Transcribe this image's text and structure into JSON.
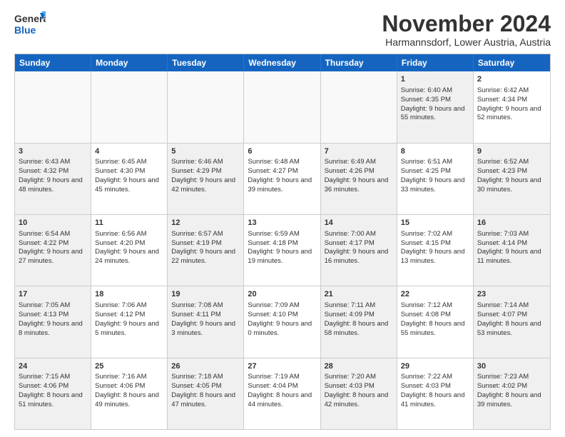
{
  "logo": {
    "line1": "General",
    "line2": "Blue"
  },
  "title": "November 2024",
  "subtitle": "Harmannsdorf, Lower Austria, Austria",
  "header_days": [
    "Sunday",
    "Monday",
    "Tuesday",
    "Wednesday",
    "Thursday",
    "Friday",
    "Saturday"
  ],
  "weeks": [
    [
      {
        "day": "",
        "info": "",
        "empty": true
      },
      {
        "day": "",
        "info": "",
        "empty": true
      },
      {
        "day": "",
        "info": "",
        "empty": true
      },
      {
        "day": "",
        "info": "",
        "empty": true
      },
      {
        "day": "",
        "info": "",
        "empty": true
      },
      {
        "day": "1",
        "info": "Sunrise: 6:40 AM\nSunset: 4:35 PM\nDaylight: 9 hours and 55 minutes.",
        "empty": false,
        "shaded": true
      },
      {
        "day": "2",
        "info": "Sunrise: 6:42 AM\nSunset: 4:34 PM\nDaylight: 9 hours and 52 minutes.",
        "empty": false,
        "shaded": false
      }
    ],
    [
      {
        "day": "3",
        "info": "Sunrise: 6:43 AM\nSunset: 4:32 PM\nDaylight: 9 hours and 48 minutes.",
        "empty": false,
        "shaded": true
      },
      {
        "day": "4",
        "info": "Sunrise: 6:45 AM\nSunset: 4:30 PM\nDaylight: 9 hours and 45 minutes.",
        "empty": false,
        "shaded": false
      },
      {
        "day": "5",
        "info": "Sunrise: 6:46 AM\nSunset: 4:29 PM\nDaylight: 9 hours and 42 minutes.",
        "empty": false,
        "shaded": true
      },
      {
        "day": "6",
        "info": "Sunrise: 6:48 AM\nSunset: 4:27 PM\nDaylight: 9 hours and 39 minutes.",
        "empty": false,
        "shaded": false
      },
      {
        "day": "7",
        "info": "Sunrise: 6:49 AM\nSunset: 4:26 PM\nDaylight: 9 hours and 36 minutes.",
        "empty": false,
        "shaded": true
      },
      {
        "day": "8",
        "info": "Sunrise: 6:51 AM\nSunset: 4:25 PM\nDaylight: 9 hours and 33 minutes.",
        "empty": false,
        "shaded": false
      },
      {
        "day": "9",
        "info": "Sunrise: 6:52 AM\nSunset: 4:23 PM\nDaylight: 9 hours and 30 minutes.",
        "empty": false,
        "shaded": true
      }
    ],
    [
      {
        "day": "10",
        "info": "Sunrise: 6:54 AM\nSunset: 4:22 PM\nDaylight: 9 hours and 27 minutes.",
        "empty": false,
        "shaded": true
      },
      {
        "day": "11",
        "info": "Sunrise: 6:56 AM\nSunset: 4:20 PM\nDaylight: 9 hours and 24 minutes.",
        "empty": false,
        "shaded": false
      },
      {
        "day": "12",
        "info": "Sunrise: 6:57 AM\nSunset: 4:19 PM\nDaylight: 9 hours and 22 minutes.",
        "empty": false,
        "shaded": true
      },
      {
        "day": "13",
        "info": "Sunrise: 6:59 AM\nSunset: 4:18 PM\nDaylight: 9 hours and 19 minutes.",
        "empty": false,
        "shaded": false
      },
      {
        "day": "14",
        "info": "Sunrise: 7:00 AM\nSunset: 4:17 PM\nDaylight: 9 hours and 16 minutes.",
        "empty": false,
        "shaded": true
      },
      {
        "day": "15",
        "info": "Sunrise: 7:02 AM\nSunset: 4:15 PM\nDaylight: 9 hours and 13 minutes.",
        "empty": false,
        "shaded": false
      },
      {
        "day": "16",
        "info": "Sunrise: 7:03 AM\nSunset: 4:14 PM\nDaylight: 9 hours and 11 minutes.",
        "empty": false,
        "shaded": true
      }
    ],
    [
      {
        "day": "17",
        "info": "Sunrise: 7:05 AM\nSunset: 4:13 PM\nDaylight: 9 hours and 8 minutes.",
        "empty": false,
        "shaded": true
      },
      {
        "day": "18",
        "info": "Sunrise: 7:06 AM\nSunset: 4:12 PM\nDaylight: 9 hours and 5 minutes.",
        "empty": false,
        "shaded": false
      },
      {
        "day": "19",
        "info": "Sunrise: 7:08 AM\nSunset: 4:11 PM\nDaylight: 9 hours and 3 minutes.",
        "empty": false,
        "shaded": true
      },
      {
        "day": "20",
        "info": "Sunrise: 7:09 AM\nSunset: 4:10 PM\nDaylight: 9 hours and 0 minutes.",
        "empty": false,
        "shaded": false
      },
      {
        "day": "21",
        "info": "Sunrise: 7:11 AM\nSunset: 4:09 PM\nDaylight: 8 hours and 58 minutes.",
        "empty": false,
        "shaded": true
      },
      {
        "day": "22",
        "info": "Sunrise: 7:12 AM\nSunset: 4:08 PM\nDaylight: 8 hours and 55 minutes.",
        "empty": false,
        "shaded": false
      },
      {
        "day": "23",
        "info": "Sunrise: 7:14 AM\nSunset: 4:07 PM\nDaylight: 8 hours and 53 minutes.",
        "empty": false,
        "shaded": true
      }
    ],
    [
      {
        "day": "24",
        "info": "Sunrise: 7:15 AM\nSunset: 4:06 PM\nDaylight: 8 hours and 51 minutes.",
        "empty": false,
        "shaded": true
      },
      {
        "day": "25",
        "info": "Sunrise: 7:16 AM\nSunset: 4:06 PM\nDaylight: 8 hours and 49 minutes.",
        "empty": false,
        "shaded": false
      },
      {
        "day": "26",
        "info": "Sunrise: 7:18 AM\nSunset: 4:05 PM\nDaylight: 8 hours and 47 minutes.",
        "empty": false,
        "shaded": true
      },
      {
        "day": "27",
        "info": "Sunrise: 7:19 AM\nSunset: 4:04 PM\nDaylight: 8 hours and 44 minutes.",
        "empty": false,
        "shaded": false
      },
      {
        "day": "28",
        "info": "Sunrise: 7:20 AM\nSunset: 4:03 PM\nDaylight: 8 hours and 42 minutes.",
        "empty": false,
        "shaded": true
      },
      {
        "day": "29",
        "info": "Sunrise: 7:22 AM\nSunset: 4:03 PM\nDaylight: 8 hours and 41 minutes.",
        "empty": false,
        "shaded": false
      },
      {
        "day": "30",
        "info": "Sunrise: 7:23 AM\nSunset: 4:02 PM\nDaylight: 8 hours and 39 minutes.",
        "empty": false,
        "shaded": true
      }
    ]
  ]
}
